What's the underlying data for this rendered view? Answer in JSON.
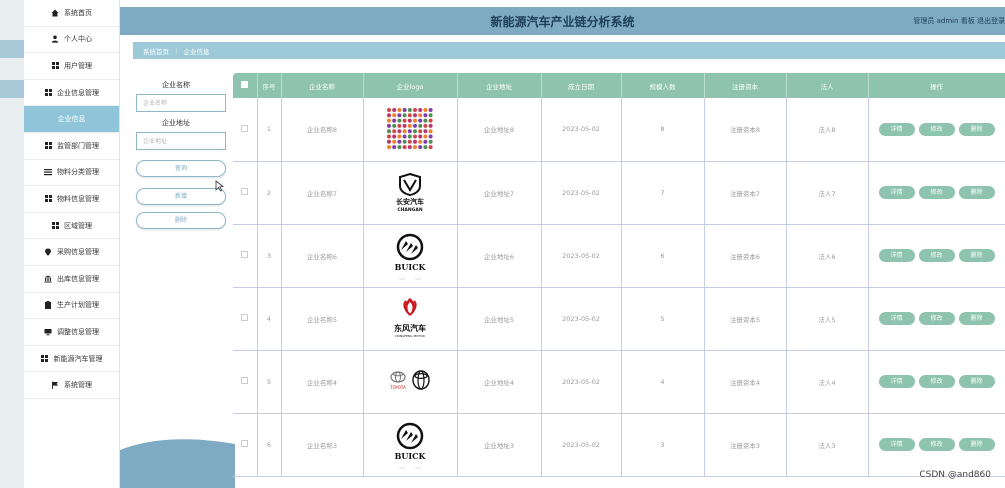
{
  "header": {
    "title": "新能源汽车产业链分析系统",
    "user_text": "管理员 admin  看板  退出登录"
  },
  "breadcrumb": {
    "home": "系统首页",
    "separator": "⋮",
    "current": "企业信息"
  },
  "sidebar": {
    "items": [
      {
        "label": "系统首页",
        "icon": "home-icon"
      },
      {
        "label": "个人中心",
        "icon": "user-icon"
      },
      {
        "label": "用户管理",
        "icon": "grid-icon"
      },
      {
        "label": "企业信息管理",
        "icon": "grid-icon"
      },
      {
        "label": "企业信息",
        "icon": "",
        "active": true
      },
      {
        "label": "监管部门管理",
        "icon": "grid-icon"
      },
      {
        "label": "物料分类管理",
        "icon": "list-icon"
      },
      {
        "label": "物料信息管理",
        "icon": "grid-icon"
      },
      {
        "label": "区域管理",
        "icon": "grid-icon"
      },
      {
        "label": "采购信息管理",
        "icon": "pin-icon"
      },
      {
        "label": "出库信息管理",
        "icon": "bank-icon"
      },
      {
        "label": "生产计划管理",
        "icon": "clipboard-icon"
      },
      {
        "label": "调整信息管理",
        "icon": "monitor-icon"
      },
      {
        "label": "新能源汽车管理",
        "icon": "grid-icon"
      },
      {
        "label": "系统管理",
        "icon": "flag-icon"
      }
    ]
  },
  "search": {
    "name_label": "企业名称",
    "name_placeholder": "企业名称",
    "address_label": "企业地址",
    "address_placeholder": "企业地址",
    "query_button": "查询",
    "add_button": "新增",
    "delete_button": "删除"
  },
  "table": {
    "columns": [
      "序号",
      "企业名称",
      "企业logo",
      "企业地址",
      "成立日期",
      "规模人数",
      "注册资本",
      "法人",
      "操作"
    ],
    "rows": [
      {
        "index": "1",
        "name": "企业名称8",
        "logo": "car-brands-collage",
        "address": "企业地址8",
        "date": "2023-05-02",
        "size": "8",
        "capital": "注册资本8",
        "legal": "法人8"
      },
      {
        "index": "2",
        "name": "企业名称7",
        "logo": "changan-logo",
        "address": "企业地址7",
        "date": "2023-05-02",
        "size": "7",
        "capital": "注册资本7",
        "legal": "法人7"
      },
      {
        "index": "3",
        "name": "企业名称6",
        "logo": "buick-logo",
        "address": "企业地址6",
        "date": "2023-05-02",
        "size": "6",
        "capital": "注册资本6",
        "legal": "法人6"
      },
      {
        "index": "4",
        "name": "企业名称5",
        "logo": "dongfeng-logo",
        "address": "企业地址5",
        "date": "2023-05-02",
        "size": "5",
        "capital": "注册资本5",
        "legal": "法人5"
      },
      {
        "index": "5",
        "name": "企业名称4",
        "logo": "toyota-logo",
        "address": "企业地址4",
        "date": "2023-05-02",
        "size": "4",
        "capital": "注册资本4",
        "legal": "法人4"
      },
      {
        "index": "6",
        "name": "企业名称3",
        "logo": "buick-logo",
        "address": "企业地址3",
        "date": "2023-05-02",
        "size": "3",
        "capital": "注册资本3",
        "legal": "法人3"
      }
    ],
    "actions": {
      "detail": "详情",
      "edit": "修改",
      "delete": "删除"
    }
  },
  "logos": {
    "changan_cn": "长安汽车",
    "changan_en": "CHANGAN",
    "buick": "BUICK",
    "dongfeng_cn": "东风汽车",
    "dongfeng_en": "DONGFENG MOTOR",
    "toyota": "TOYOTA"
  },
  "watermark": "CSDN @and860",
  "colors": {
    "header": "#7eaac4",
    "breadcrumb": "#9ccad9",
    "table_header": "#8ec3b0",
    "action_button": "#8ec3b0",
    "sidebar_active": "#90c4d8"
  }
}
